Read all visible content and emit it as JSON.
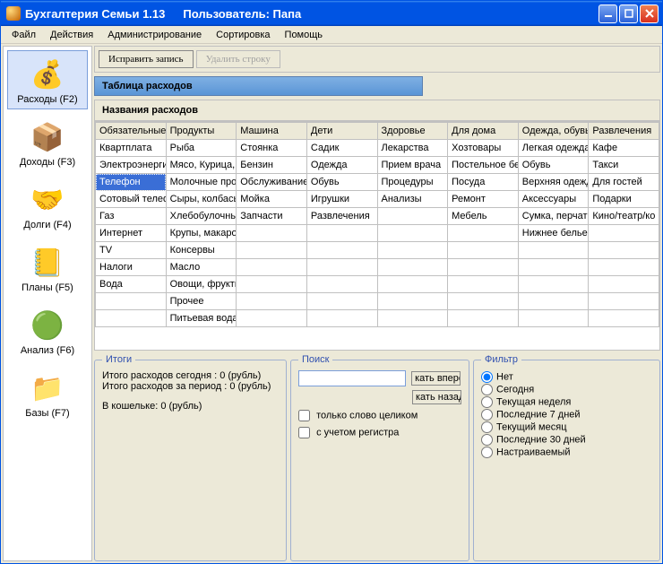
{
  "window": {
    "title": "Бухгалтерия Семьи 1.13",
    "user_label": "Пользователь: Папа"
  },
  "menu": [
    "Файл",
    "Действия",
    "Администрирование",
    "Сортировка",
    "Помощь"
  ],
  "sidebar": [
    {
      "label": "Расходы (F2)",
      "icon": "💰"
    },
    {
      "label": "Доходы (F3)",
      "icon": "📦"
    },
    {
      "label": "Долги (F4)",
      "icon": "🤝"
    },
    {
      "label": "Планы (F5)",
      "icon": "📒"
    },
    {
      "label": "Анализ (F6)",
      "icon": "🟢"
    },
    {
      "label": "Базы (F7)",
      "icon": "📁"
    }
  ],
  "toolbar": {
    "edit_label": "Исправить запись",
    "delete_label": "Удалить строку"
  },
  "section_title": "Таблица расходов",
  "sub_title": "Названия расходов",
  "table": {
    "headers": [
      "Обязательные",
      "Продукты",
      "Машина",
      "Дети",
      "Здоровье",
      "Для дома",
      "Одежда, обувь",
      "Развлечения"
    ],
    "rows": [
      [
        "Квартплата",
        "Рыба",
        "Стоянка",
        "Садик",
        "Лекарства",
        "Хозтовары",
        "Легкая одежда",
        "Кафе"
      ],
      [
        "Электроэнергия",
        "Мясо, Курица,",
        "Бензин",
        "Одежда",
        "Прием врача",
        "Постельное белье",
        "Обувь",
        "Такси"
      ],
      [
        "Телефон",
        "Молочные продукты",
        "Обслуживание",
        "Обувь",
        "Процедуры",
        "Посуда",
        "Верхняя одежда",
        "Для гостей"
      ],
      [
        "Сотовый телефон",
        "Сыры, колбасы",
        "Мойка",
        "Игрушки",
        "Анализы",
        "Ремонт",
        "Аксессуары",
        "Подарки"
      ],
      [
        "Газ",
        "Хлебобулочные",
        "Запчасти",
        "Развлечения",
        "",
        "Мебель",
        "Сумка, перчатки",
        "Кино/театр/ко"
      ],
      [
        "Интернет",
        "Крупы, макароны",
        "",
        "",
        "",
        "",
        "Нижнее белье",
        ""
      ],
      [
        "TV",
        "Консервы",
        "",
        "",
        "",
        "",
        "",
        ""
      ],
      [
        "Налоги",
        "Масло",
        "",
        "",
        "",
        "",
        "",
        ""
      ],
      [
        "Вода",
        "Овощи, фрукты",
        "",
        "",
        "",
        "",
        "",
        ""
      ],
      [
        "",
        "Прочее",
        "",
        "",
        "",
        "",
        "",
        ""
      ],
      [
        "",
        "Питьевая вода",
        "",
        "",
        "",
        "",
        "",
        ""
      ]
    ],
    "selected": {
      "row": 2,
      "col": 0
    }
  },
  "totals": {
    "legend": "Итоги",
    "today": "Итого расходов сегодня : 0 (рубль)",
    "period": "Итого расходов за период : 0 (рубль)",
    "wallet": "В кошельке: 0 (рубль)"
  },
  "search": {
    "legend": "Поиск",
    "forward_label": "кать вперед",
    "back_label": "кать назад",
    "whole_word_label": "только слово целиком",
    "case_label": "с учетом регистра"
  },
  "filter": {
    "legend": "Фильтр",
    "options": [
      "Нет",
      "Сегодня",
      "Текущая неделя",
      "Последние 7 дней",
      "Текущий месяц",
      "Последние 30 дней",
      "Настраиваемый"
    ],
    "selected": 0
  }
}
